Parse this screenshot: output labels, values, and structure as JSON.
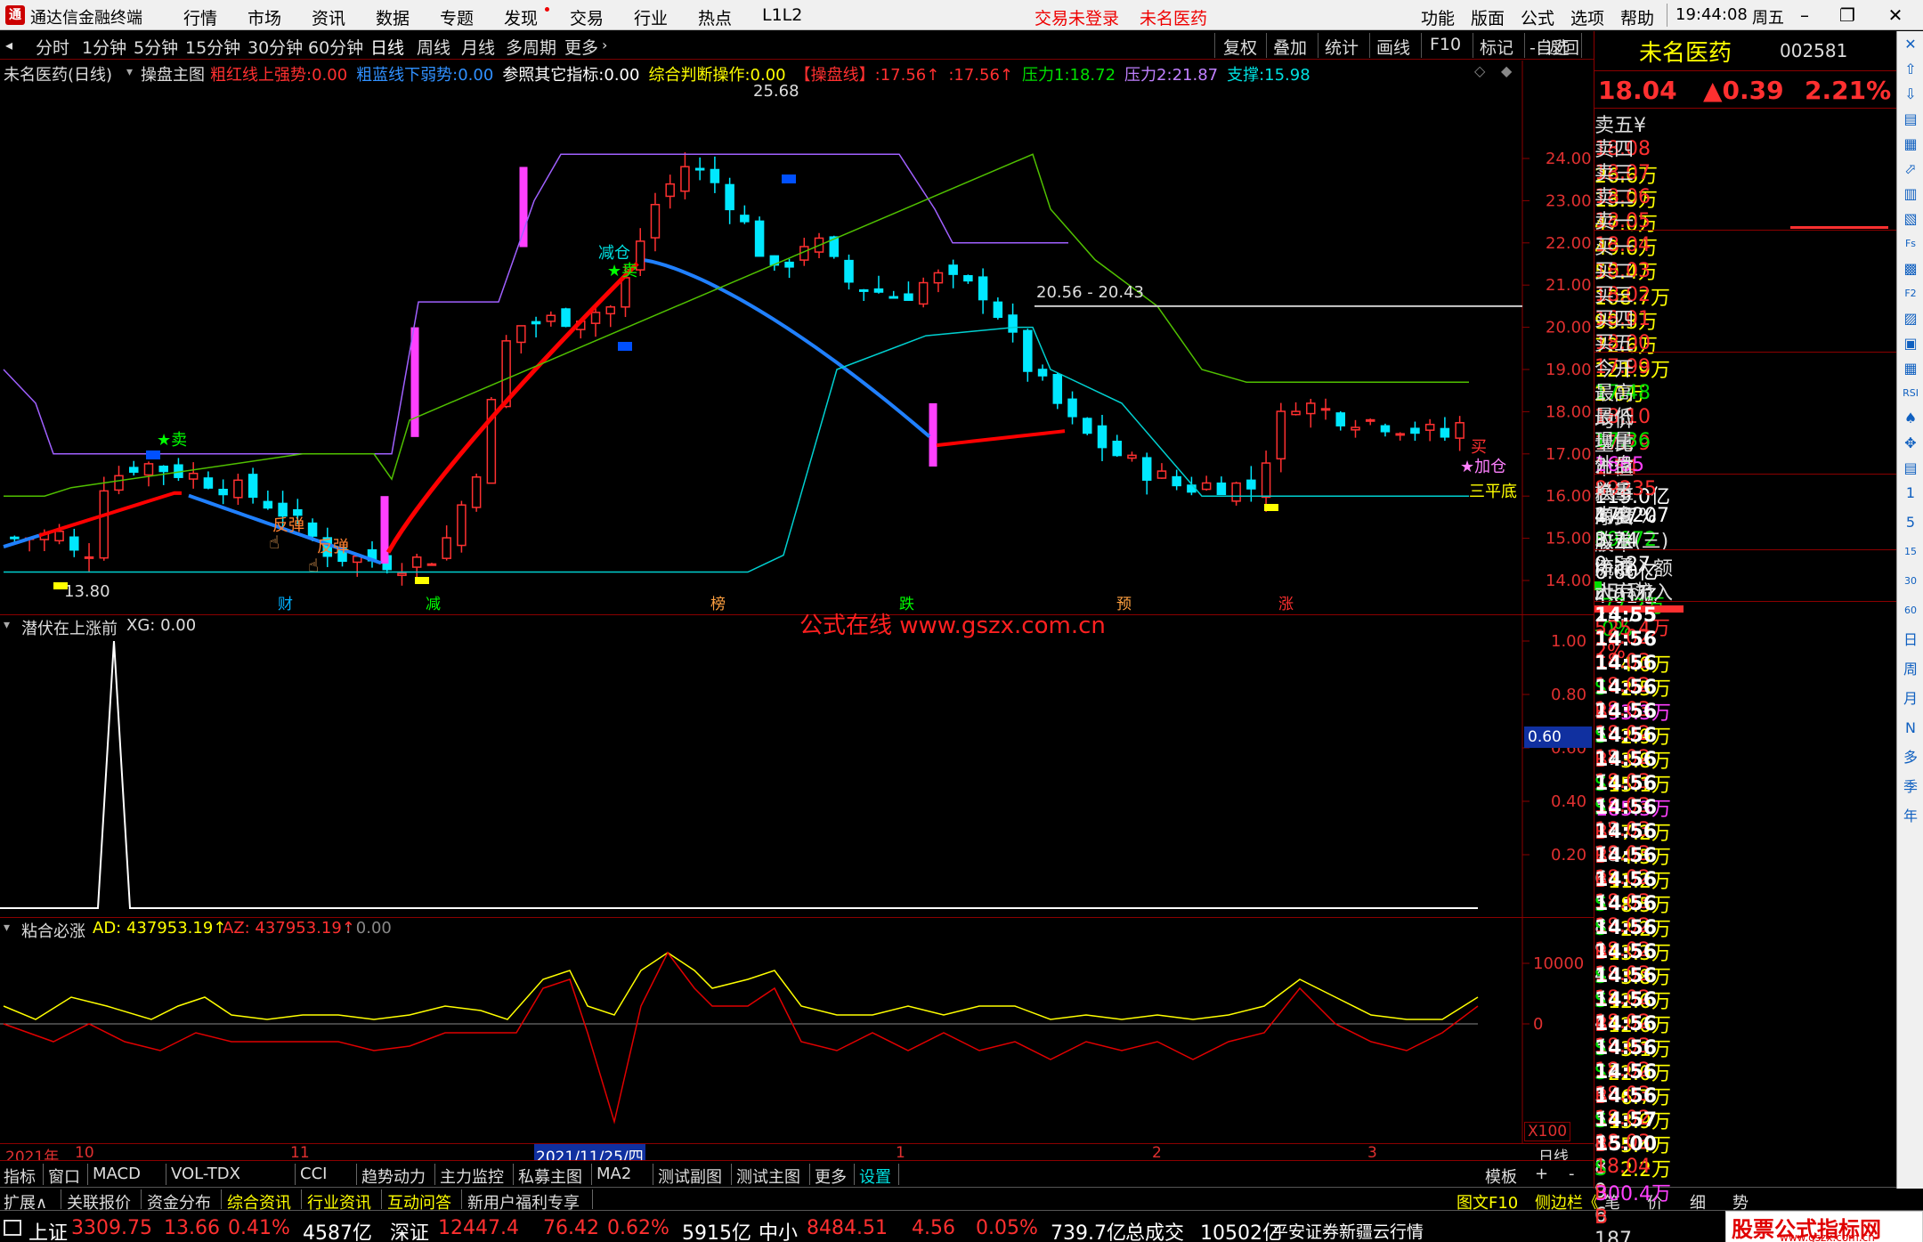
{
  "app": {
    "title": "通达信金融终端",
    "menu": [
      "行情",
      "市场",
      "资讯",
      "数据",
      "专题",
      "发现",
      "交易",
      "行业",
      "热点",
      "L1L2"
    ],
    "login_status": "交易未登录",
    "stock_name_top": "未名医药",
    "right_menu": [
      "功能",
      "版面",
      "公式",
      "选项",
      "帮助"
    ],
    "clock": "19:44:08",
    "weekday": "周五"
  },
  "toolbar": {
    "periods": [
      "分时",
      "1分钟",
      "5分钟",
      "15分钟",
      "30分钟",
      "60分钟",
      "日线",
      "周线",
      "月线",
      "多周期",
      "更多"
    ],
    "selected": "日线",
    "right_tools": [
      "复权",
      "叠加",
      "统计",
      "画线",
      "F10",
      "标记",
      "-自选",
      "返回"
    ]
  },
  "main_chart": {
    "title": "未名医药(日线)",
    "indicator_name": "操盘主图",
    "params": [
      {
        "label": "粗红线上强势:",
        "value": "0.00",
        "color": "#ff3030"
      },
      {
        "label": "粗蓝线下弱势:",
        "value": "0.00",
        "color": "#3090ff"
      },
      {
        "label": "参照其它指标:",
        "value": "0.00",
        "color": "#ffffff"
      },
      {
        "label": "综合判断操作:",
        "value": "0.00",
        "color": "#ffff00"
      },
      {
        "label": "【操盘线】:",
        "value": "17.56↑",
        "color": "#ff3030"
      },
      {
        "label": ":",
        "value": "17.56↑",
        "color": "#ff3030"
      },
      {
        "label": "压力1:",
        "value": "18.72",
        "color": "#00e000"
      },
      {
        "label": "压力2:",
        "value": "21.87",
        "color": "#c080ff"
      },
      {
        "label": "支撑:",
        "value": "15.98",
        "color": "#00e0e0"
      }
    ],
    "y_ticks": [
      "24.00",
      "23.00",
      "22.00",
      "21.00",
      "20.00",
      "19.00",
      "18.00",
      "17.00",
      "16.00",
      "15.00",
      "14.00"
    ],
    "high_label": "25.68",
    "low_label": "13.80",
    "range_label": "20.56 - 20.43",
    "annotations": [
      "减仓",
      "卖",
      "卖",
      "反弹",
      "反弹",
      "买",
      "加仓",
      "三平底"
    ],
    "event_markers": [
      "财",
      "减",
      "榜",
      "跌",
      "预",
      "涨"
    ],
    "watermark": "公式在线 www.gszx.com.cn"
  },
  "sub1": {
    "title": "潜伏在上涨前",
    "param": "XG: 0.00",
    "y_ticks": [
      "1.00",
      "0.80",
      "0.60",
      "0.40",
      "0.20"
    ],
    "cursor_value": "0.60"
  },
  "sub2": {
    "title": "粘合必涨",
    "ad": "AD: 437953.19↑",
    "az": "AZ: 437953.19↑",
    "extra": ": 0.00",
    "y_ticks": [
      "10000",
      "0"
    ],
    "scale": "X100"
  },
  "x_axis": {
    "labels": [
      "2021年",
      "10",
      "11",
      "2021/11/25/四",
      "1",
      "2",
      "3"
    ],
    "period": "日线"
  },
  "bottom_tabs": [
    "指标",
    "窗口",
    "MACD",
    "VOL-TDX",
    "CCI",
    "趋势动力",
    "主力监控",
    "私募主图",
    "MA2",
    "测试副图",
    "测试主图",
    "更多",
    "设置"
  ],
  "bottom_right": [
    "模板",
    "+",
    "-"
  ],
  "foot_links": [
    "扩展∧",
    "关联报价",
    "资金分布",
    "综合资讯",
    "行业资讯",
    "互动问答",
    "新用户福利专享"
  ],
  "foot_right": [
    "图文F10",
    "侧边栏《",
    "笔",
    "价",
    "细",
    "势"
  ],
  "quote": {
    "name": "未名医药",
    "code": "002581",
    "price": "18.04",
    "change": "▲0.39",
    "pct": "2.21%",
    "asks": [
      {
        "label": "卖五¥",
        "price": "18.08",
        "vol": "26.6万"
      },
      {
        "label": "卖四",
        "price": "18.07",
        "vol": "13.9万"
      },
      {
        "label": "卖三",
        "price": "18.06",
        "vol": "47.0万"
      },
      {
        "label": "卖二",
        "price": "18.05",
        "vol": "49.6万"
      },
      {
        "label": "卖一",
        "price": "18.04",
        "vol": "59.4万"
      }
    ],
    "bids": [
      {
        "label": "买一",
        "price": "18.03",
        "vol": "108.7万"
      },
      {
        "label": "买二",
        "price": "18.02",
        "vol": "99.3万"
      },
      {
        "label": "买三",
        "price": "18.01",
        "vol": "72.6万"
      },
      {
        "label": "买四",
        "price": "18.00",
        "vol": "121.9万"
      },
      {
        "label": "买五",
        "price": "17.99",
        "vol": "2.0万"
      }
    ],
    "stats": [
      {
        "l1": "今开",
        "v1": "17.48",
        "c1": "#00e000",
        "l2": "均价",
        "v2": "17.79",
        "c2": "#ff3030"
      },
      {
        "l1": "最高",
        "v1": "18.10",
        "c1": "#ff3030",
        "l2": "量比",
        "v2": "1.54",
        "c2": "#ff3030"
      },
      {
        "l1": "最低",
        "v1": "17.36",
        "c1": "#00e000",
        "l2": "市值",
        "v2": "119.0亿",
        "c2": "#ffffff"
      },
      {
        "l1": "现量",
        "v1": "1665",
        "c1": "#ff40ff",
        "l2": "总量",
        "v2": "179207",
        "c2": "#ffffff"
      },
      {
        "l1": "外盘",
        "v1": "89235",
        "c1": "#ff3030",
        "l2": "内盘",
        "v2": "89972",
        "c2": "#00e000"
      }
    ],
    "stats2": [
      {
        "l1": "换手",
        "v1": "4.47%",
        "l2": "股本",
        "v2": "6.60亿"
      },
      {
        "l1": "净资",
        "v1": "3.74",
        "l2": "流通",
        "v2": "4.01亿"
      },
      {
        "l1": "收益(三)",
        "v1": "0.527",
        "l2": "PE(动)",
        "v2": "25.7"
      }
    ],
    "flow": [
      {
        "label": "净流入额",
        "value": "-77.2万",
        "pct": "-0%",
        "color": "#00e000"
      },
      {
        "label": "大宗流入",
        "value": "525.4万",
        "pct": "2%",
        "color": "#ff3030"
      }
    ],
    "ticks": [
      {
        "t": "14:55",
        "p": "18.02",
        "v": "4.0万",
        "s": "S",
        "n": "2"
      },
      {
        "t": "14:56",
        "p": "18.03",
        "v": "2.5万",
        "s": "B",
        "n": "5"
      },
      {
        "t": "14:56",
        "p": "18.02",
        "v": "93.3万",
        "s": "S",
        "n": "17"
      },
      {
        "t": "14:56",
        "p": "18.03",
        "v": "2.9万",
        "s": "B",
        "n": "7"
      },
      {
        "t": "14:56",
        "p": "18.02",
        "v": "3.8万",
        "s": "S",
        "n": "5"
      },
      {
        "t": "14:56",
        "p": "18.02",
        "v": "15.1万",
        "s": "S",
        "n": "17"
      },
      {
        "t": "14:56",
        "p": "18.03",
        "v": "185.3万",
        "s": "B",
        "n": "78"
      },
      {
        "t": "14:56",
        "p": "18.03",
        "v": "7.2万",
        "s": "B",
        "n": "6"
      },
      {
        "t": "14:56",
        "p": "18.03",
        "v": "4.5万",
        "s": "B",
        "n": "5"
      },
      {
        "t": "14:56",
        "p": "18.03",
        "v": "11.2万",
        "s": "S",
        "n": "8"
      },
      {
        "t": "14:56",
        "p": "18.02",
        "v": "8.5万",
        "s": "S",
        "n": "9"
      },
      {
        "t": "14:56",
        "p": "18.03",
        "v": "2.2万",
        "s": "B",
        "n": "4"
      },
      {
        "t": "14:56",
        "p": "18.02",
        "v": "13.3万",
        "s": "S",
        "n": "5"
      },
      {
        "t": "14:56",
        "p": "18.02",
        "v": "3.8万",
        "s": "S",
        "n": "4"
      },
      {
        "t": "14:56",
        "p": "18.03",
        "v": "12.6万",
        "s": "B",
        "n": "5"
      },
      {
        "t": "14:56",
        "p": "18.02",
        "v": "12.6万",
        "s": "S",
        "n": "12"
      },
      {
        "t": "14:56",
        "p": "18.02",
        "v": "3.1万",
        "s": "S",
        "n": "5"
      },
      {
        "t": "14:56",
        "p": "18.03",
        "v": "22.0万",
        "s": "B",
        "n": "5"
      },
      {
        "t": "14:56",
        "p": "18.02",
        "v": "6.7万",
        "s": "S",
        "n": "8"
      },
      {
        "t": "14:56",
        "p": "18.03",
        "v": "13.9万",
        "s": "B",
        "n": "8"
      },
      {
        "t": "14:56",
        "p": "18.02",
        "v": "5.4万",
        "s": "S",
        "n": "9"
      },
      {
        "t": "14:57",
        "p": "18.03",
        "v": "2.2万",
        "s": "B",
        "n": "6"
      },
      {
        "t": "15:00",
        "p": "18.04",
        "v": "300.4万",
        "s": "B",
        "n": "187"
      }
    ]
  },
  "iconstrip": [
    "✕",
    "⇧",
    "⇩",
    "▤",
    "▦",
    "⬀",
    "▥",
    "▧",
    "Fs",
    "▩",
    "F2",
    "▨",
    "▣",
    "▦",
    "RSI",
    "♠",
    "✥",
    "▤",
    "1",
    "5",
    "15",
    "30",
    "60",
    "日",
    "周",
    "月",
    "N",
    "多",
    "季",
    "年"
  ],
  "status": {
    "items": [
      {
        "name": "上证",
        "v": "3309.75",
        "c": "13.66",
        "p": "0.41%",
        "amt": "4587亿"
      },
      {
        "name": "深证",
        "v": "12447.4",
        "c": "76.42",
        "p": "0.62%",
        "amt": "5915亿"
      },
      {
        "name": "中小",
        "v": "8484.51",
        "c": "4.56",
        "p": "0.05%",
        "amt": "739.7亿"
      }
    ],
    "total_label": "总成交",
    "total": "10502亿",
    "broker": "平安证券新疆云行情",
    "brand": "股票公式指标网",
    "brand_url": "www.gszx.com.cn"
  },
  "colors": {
    "red": "#ff3030",
    "cyan": "#00e0e0",
    "blue_line": "#2080ff",
    "red_line": "#ff0000",
    "magenta": "#ff40ff",
    "yellow": "#ffff00"
  }
}
